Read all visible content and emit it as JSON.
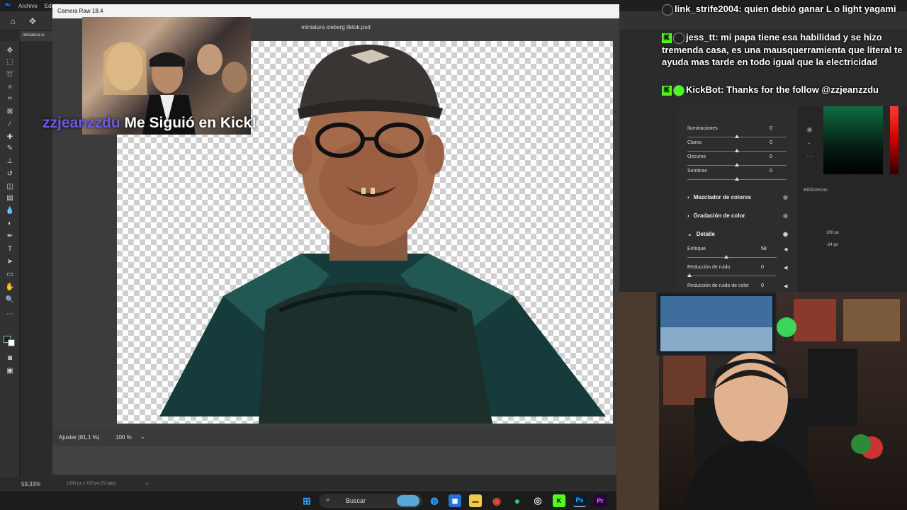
{
  "photoshop": {
    "menu": [
      "Archivo",
      "Edición"
    ],
    "doc_tab": "miniatura ic",
    "zoom_status": "59,33%",
    "doc_info": "1280 px x 720 px (72 ppp)"
  },
  "camera_raw": {
    "title": "Camera Raw 18.4",
    "file_name": "miniatura iceberg tiktok.psd",
    "fit_label": "Ajustar (81,1 %)",
    "zoom_label": "100 %",
    "sliders_top": [
      {
        "label": "Iluminaciones",
        "value": "0"
      },
      {
        "label": "Claros",
        "value": "0"
      },
      {
        "label": "Oscuros",
        "value": "0"
      },
      {
        "label": "Sombras",
        "value": "0"
      }
    ],
    "sections": [
      {
        "label": "Mezclador de colores",
        "expanded": false
      },
      {
        "label": "Gradación de color",
        "expanded": false
      },
      {
        "label": "Detalle",
        "expanded": true
      }
    ],
    "detail_sliders": [
      {
        "label": "Enfoque",
        "value": "58",
        "level": 0.58
      },
      {
        "label": "Reducción de ruido",
        "value": "0",
        "level": 0.0
      },
      {
        "label": "Reducción de ruido de color",
        "value": "0",
        "level": 0.0
      }
    ]
  },
  "right_panel": {
    "libraries_label": "Bibliotecas",
    "field1": "100 px",
    "field2": "-24 px",
    "accent_color": "#0e6b42"
  },
  "chat": {
    "messages": [
      {
        "user": "link_strife2004",
        "text": "quien debió ganar L o light yagami"
      },
      {
        "user": "jess_tt",
        "text": "mi papa tiene esa habilidad y se hizo tremenda casa, es una mausquerramienta que literal te ayuda mas tarde en todo igual que la electricidad"
      },
      {
        "user": "KickBot",
        "text": "Thanks for the follow @zzjeanzzdu"
      }
    ],
    "kick_color": "#53fc18"
  },
  "alert": {
    "username": "zzjeanzzdu",
    "message": "Me Siguió en Kick!",
    "username_color": "#6b5ce7"
  },
  "taskbar": {
    "search_label": "Buscar"
  }
}
